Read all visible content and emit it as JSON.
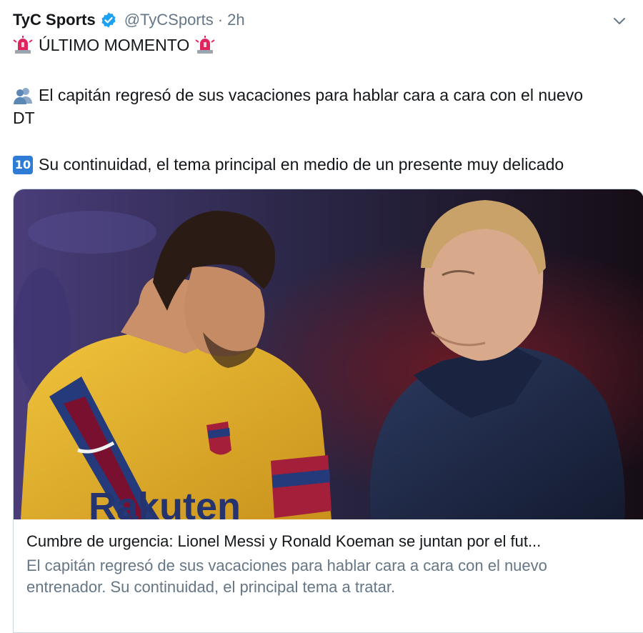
{
  "tweet": {
    "display_name": "TyC Sports",
    "handle": "@TyCSports",
    "separator": "·",
    "time": "2h",
    "headline": "ÚLTIMO MOMENTO",
    "paragraph1": "El capitán regresó de sus vacaciones para hablar cara a cara con el nuevo",
    "paragraph1_cont": "DT",
    "ten_badge": "10",
    "paragraph2": "Su continuidad, el tema principal en medio de un presente muy delicado"
  },
  "card": {
    "title": "Cumbre de urgencia: Lionel Messi y Ronald Koeman se juntan por el fut...",
    "description_line1": "El capitán regresó de sus vacaciones para hablar cara a cara con el nuevo",
    "description_line2": "entrenador. Su continuidad, el principal tema a tratar.",
    "image_sponsor_text": "Rakuten"
  },
  "colors": {
    "text_primary": "#14171a",
    "text_secondary": "#657786",
    "verified_blue": "#1da1f2",
    "siren_red": "#e0245e",
    "jersey_yellow": "#e7b62a",
    "jacket_navy": "#1f2a48"
  },
  "icons": {
    "verified": "verified-badge-icon",
    "caret": "chevron-down-icon",
    "siren": "rotating-light-emoji",
    "people": "busts-in-silhouette-emoji",
    "ten": "keycap-ten-emoji"
  }
}
